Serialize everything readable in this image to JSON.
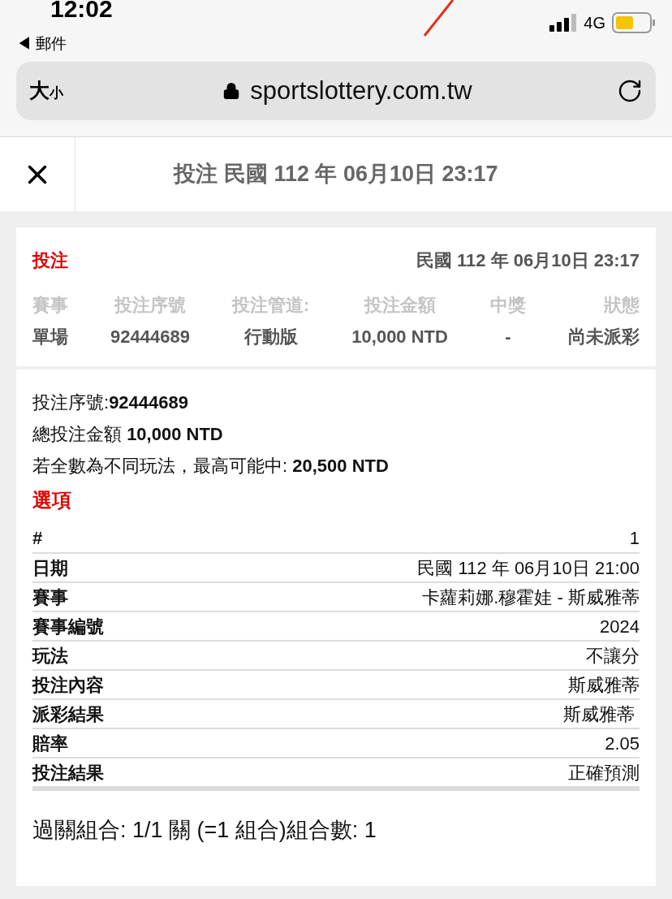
{
  "status_bar": {
    "time": "12:02",
    "back_app": "◀ 郵件",
    "network": "4G"
  },
  "browser": {
    "text_size": "大",
    "text_size_small": "小",
    "url": "sportslottery.com.tw"
  },
  "header": {
    "title": "投注 民國 112 年 06月10日 23:17"
  },
  "summary": {
    "label": "投注",
    "datetime": "民國 112 年 06月10日 23:17",
    "columns": [
      {
        "heading": "賽事",
        "value": "單場"
      },
      {
        "heading": "投注序號",
        "value": "92444689"
      },
      {
        "heading": "投注管道:",
        "value": "行動版"
      },
      {
        "heading": "投注金額",
        "value": "10,000 NTD"
      },
      {
        "heading": "中獎",
        "value": "-"
      },
      {
        "heading": "狀態",
        "value": "尚未派彩"
      }
    ]
  },
  "details": {
    "lines": [
      "投注序號:**92444689**",
      "總投注金額 **10,000 NTD**",
      "若全數為不同玩法，最高可能中: **20,500 NTD**"
    ],
    "options_title": "選項",
    "rows": [
      {
        "label": "#",
        "value": "1"
      },
      {
        "label": "日期",
        "value": "民國 112 年 06月10日 21:00"
      },
      {
        "label": "賽事",
        "value": "卡蘿莉娜.穆霍娃 - 斯威雅蒂"
      },
      {
        "label": "賽事編號",
        "value": "2024"
      },
      {
        "label": "玩法",
        "value": "不讓分"
      },
      {
        "label": "投注內容",
        "value": "斯威雅蒂"
      },
      {
        "label": "派彩結果",
        "value": "斯威雅蒂 "
      },
      {
        "label": "賠率",
        "value": "2.05"
      },
      {
        "label": "投注結果",
        "value": "正確預測"
      }
    ],
    "combination": "過關組合: 1/1 關 (=1 組合)組合數: 1"
  }
}
